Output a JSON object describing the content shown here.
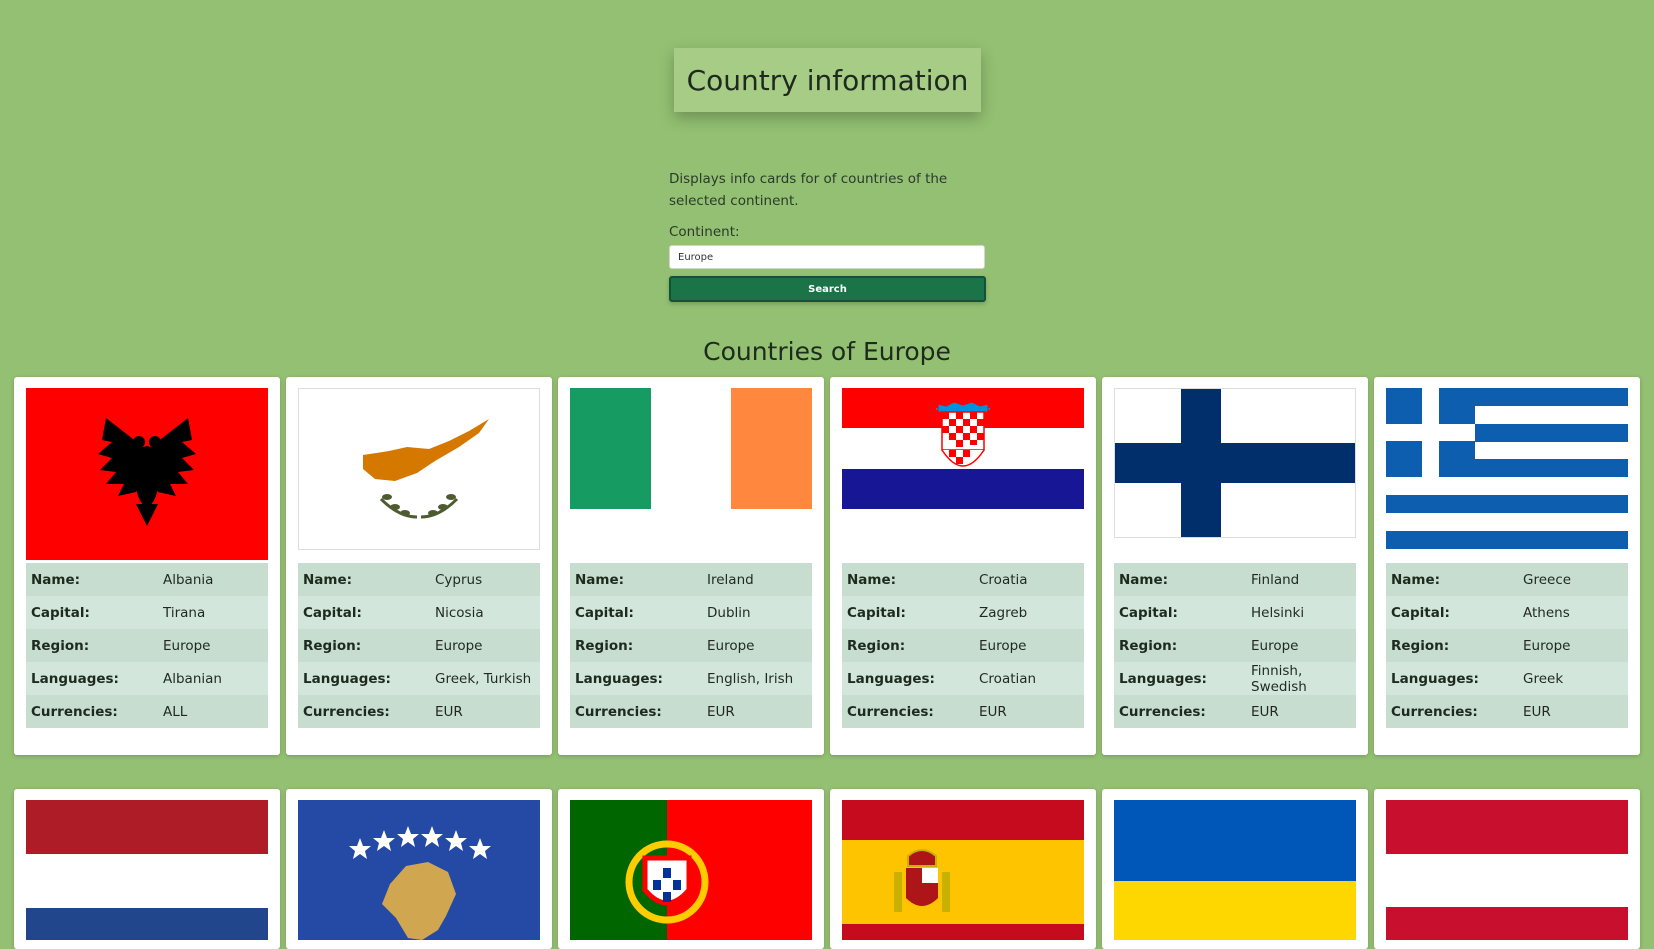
{
  "header": {
    "title": "Country information"
  },
  "form": {
    "description": "Displays info cards for of countries of the selected continent.",
    "continent_label": "Continent:",
    "continent_value": "Europe",
    "search_label": "Search"
  },
  "section": {
    "title": "Countries of Europe"
  },
  "field_labels": {
    "name": "Name:",
    "capital": "Capital:",
    "region": "Region:",
    "languages": "Languages:",
    "currencies": "Currencies:"
  },
  "countries": [
    {
      "name": "Albania",
      "capital": "Tirana",
      "region": "Europe",
      "languages": "Albanian",
      "currencies": "ALL",
      "flag_icon": "albania-flag-icon"
    },
    {
      "name": "Cyprus",
      "capital": "Nicosia",
      "region": "Europe",
      "languages": "Greek, Turkish",
      "currencies": "EUR",
      "flag_icon": "cyprus-flag-icon"
    },
    {
      "name": "Ireland",
      "capital": "Dublin",
      "region": "Europe",
      "languages": "English, Irish",
      "currencies": "EUR",
      "flag_icon": "ireland-flag-icon"
    },
    {
      "name": "Croatia",
      "capital": "Zagreb",
      "region": "Europe",
      "languages": "Croatian",
      "currencies": "EUR",
      "flag_icon": "croatia-flag-icon"
    },
    {
      "name": "Finland",
      "capital": "Helsinki",
      "region": "Europe",
      "languages": "Finnish, Swedish",
      "currencies": "EUR",
      "flag_icon": "finland-flag-icon"
    },
    {
      "name": "Greece",
      "capital": "Athens",
      "region": "Europe",
      "languages": "Greek",
      "currencies": "EUR",
      "flag_icon": "greece-flag-icon"
    }
  ],
  "partial_flags": [
    "netherlands-flag-icon",
    "kosovo-flag-icon",
    "portugal-flag-icon",
    "spain-flag-icon",
    "ukraine-flag-icon",
    "austria-flag-icon"
  ],
  "colors": {
    "background": "#93c072",
    "button": "#1a7448",
    "title_box": "#a6cc86"
  }
}
